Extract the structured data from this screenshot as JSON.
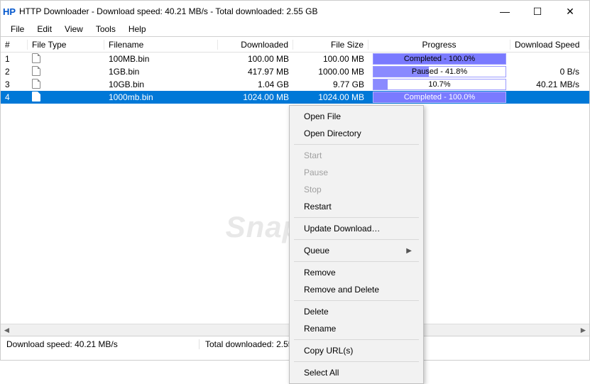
{
  "title": "HTTP Downloader - Download speed:  40.21 MB/s - Total downloaded:  2.55 GB",
  "app_icon_text": "HP",
  "window_controls": {
    "min": "—",
    "max": "☐",
    "close": "✕"
  },
  "menubar": [
    "File",
    "Edit",
    "View",
    "Tools",
    "Help"
  ],
  "columns": {
    "num": "#",
    "type": "File Type",
    "name": "Filename",
    "downloaded": "Downloaded",
    "size": "File Size",
    "progress": "Progress",
    "speed": "Download Speed"
  },
  "rows": [
    {
      "num": "1",
      "name": "100MB.bin",
      "downloaded": "100.00 MB",
      "size": "100.00 MB",
      "progress_label": "Completed - 100.0%",
      "progress_pct": 100,
      "speed": "",
      "selected": false
    },
    {
      "num": "2",
      "name": "1GB.bin",
      "downloaded": "417.97 MB",
      "size": "1000.00 MB",
      "progress_label": "Paused - 41.8%",
      "progress_pct": 41.8,
      "speed": "0 B/s",
      "selected": false
    },
    {
      "num": "3",
      "name": "10GB.bin",
      "downloaded": "1.04 GB",
      "size": "9.77 GB",
      "progress_label": "10.7%",
      "progress_pct": 10.7,
      "speed": "40.21 MB/s",
      "selected": false
    },
    {
      "num": "4",
      "name": "1000mb.bin",
      "downloaded": "1024.00 MB",
      "size": "1024.00 MB",
      "progress_label": "Completed - 100.0%",
      "progress_pct": 100,
      "speed": "",
      "selected": true
    }
  ],
  "watermark": "Snapfiles",
  "statusbar": {
    "speed": "Download speed:  40.21 MB/s",
    "total": "Total downloaded:  2.55 GB"
  },
  "context_menu": [
    {
      "label": "Open File",
      "type": "item"
    },
    {
      "label": "Open Directory",
      "type": "item"
    },
    {
      "type": "sep"
    },
    {
      "label": "Start",
      "type": "item",
      "disabled": true
    },
    {
      "label": "Pause",
      "type": "item",
      "disabled": true
    },
    {
      "label": "Stop",
      "type": "item",
      "disabled": true
    },
    {
      "label": "Restart",
      "type": "item"
    },
    {
      "type": "sep"
    },
    {
      "label": "Update Download…",
      "type": "item"
    },
    {
      "type": "sep"
    },
    {
      "label": "Queue",
      "type": "item",
      "submenu": true
    },
    {
      "type": "sep"
    },
    {
      "label": "Remove",
      "type": "item"
    },
    {
      "label": "Remove and Delete",
      "type": "item"
    },
    {
      "type": "sep"
    },
    {
      "label": "Delete",
      "type": "item"
    },
    {
      "label": "Rename",
      "type": "item"
    },
    {
      "type": "sep"
    },
    {
      "label": "Copy URL(s)",
      "type": "item"
    },
    {
      "type": "sep"
    },
    {
      "label": "Select All",
      "type": "item"
    }
  ]
}
